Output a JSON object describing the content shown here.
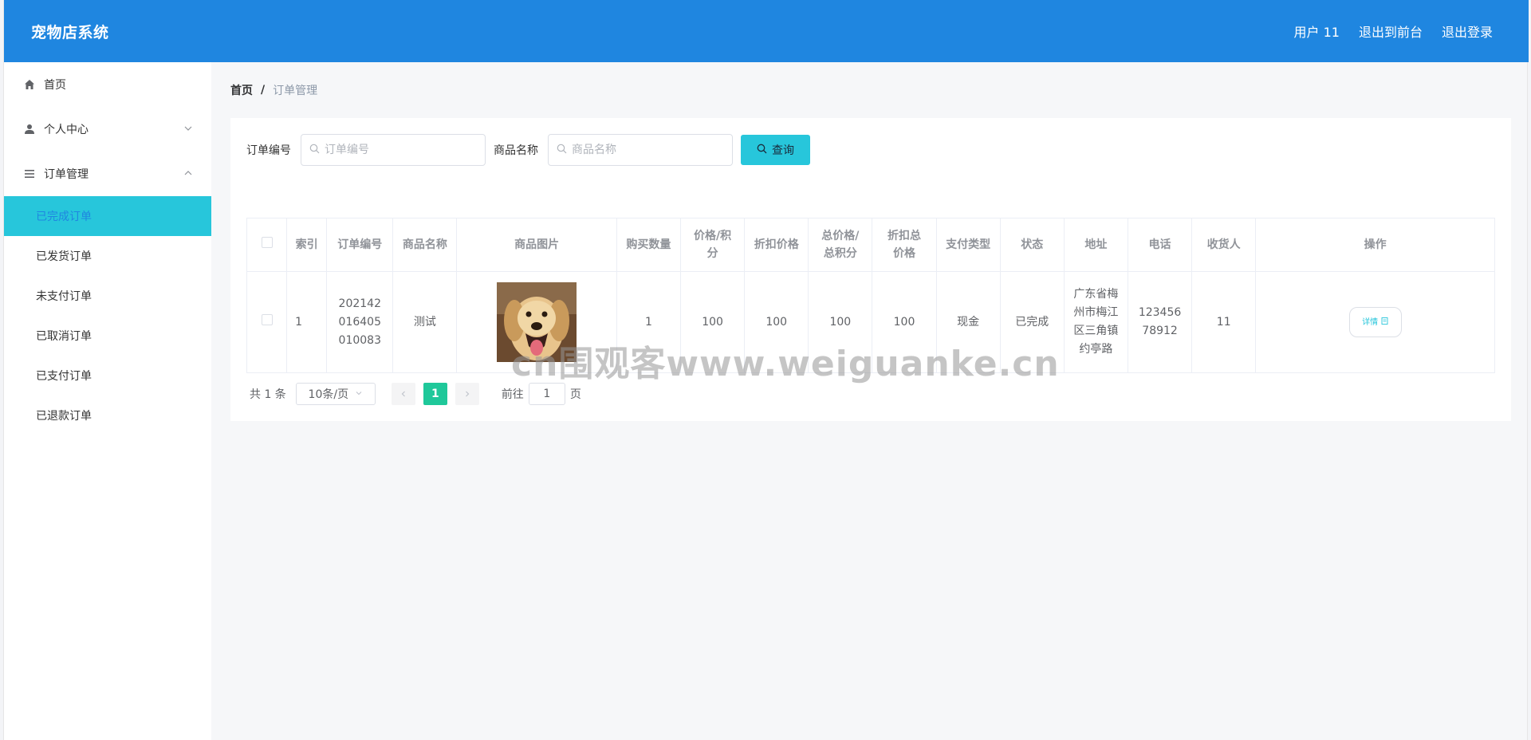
{
  "header": {
    "title": "宠物店系统",
    "links": [
      "用户 11",
      "退出到前台",
      "退出登录"
    ]
  },
  "sidebar": {
    "home": "首页",
    "personal": "个人中心",
    "orders": "订单管理",
    "sub_items": [
      "已完成订单",
      "已发货订单",
      "未支付订单",
      "已取消订单",
      "已支付订单",
      "已退款订单"
    ],
    "active_index": 0
  },
  "breadcrumb": {
    "home": "首页",
    "sep": "/",
    "current": "订单管理"
  },
  "search": {
    "order_no_label": "订单编号",
    "order_no_placeholder": "订单编号",
    "product_label": "商品名称",
    "product_placeholder": "商品名称",
    "query_label": "查询"
  },
  "table": {
    "headers": [
      "索引",
      "订单编号",
      "商品名称",
      "商品图片",
      "购买数量",
      "价格/积分",
      "折扣价格",
      "总价格/总积分",
      "折扣总价格",
      "支付类型",
      "状态",
      "地址",
      "电话",
      "收货人",
      "操作"
    ],
    "rows": [
      {
        "index": "1",
        "order_no": "202142016405010083",
        "product": "测试",
        "qty": "1",
        "price": "100",
        "discount_price": "100",
        "total": "100",
        "discount_total": "100",
        "pay_type": "现金",
        "status": "已完成",
        "address": "广东省梅州市梅江区三角镇约亭路",
        "phone": "12345678912",
        "receiver": "11",
        "action": "详情"
      }
    ]
  },
  "pager": {
    "total": "共 1 条",
    "page_size": "10条/页",
    "current_page": "1",
    "goto_label": "前往",
    "goto_value": "1",
    "page_suffix": "页"
  },
  "watermark": "cn围观客www.weiguanke.cn",
  "colors": {
    "header": "#1f86e0",
    "accent": "#27c6db",
    "pager_active": "#1fc89a"
  }
}
